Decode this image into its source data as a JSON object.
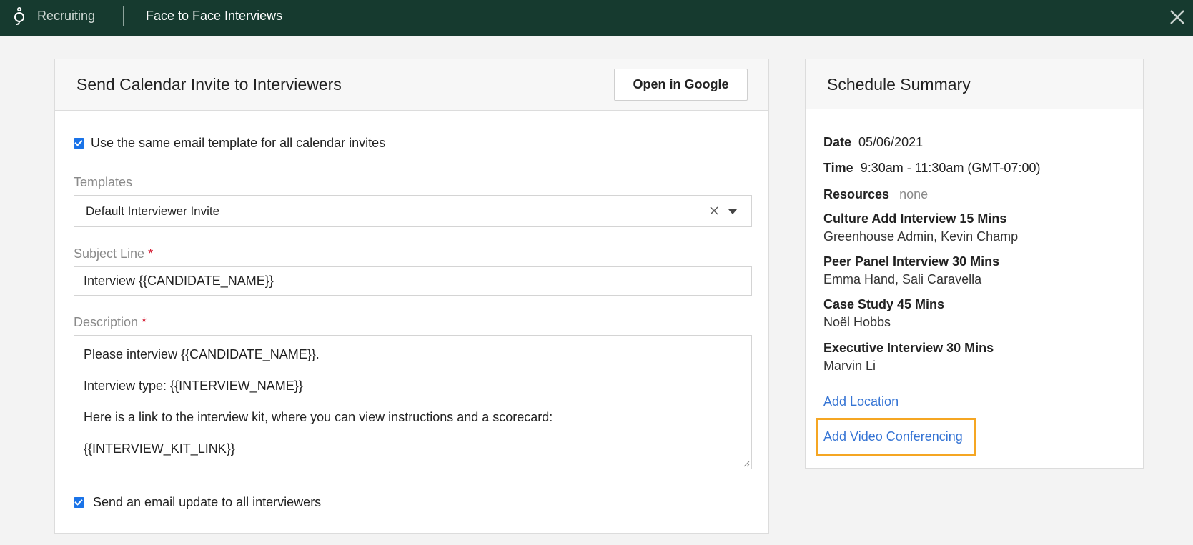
{
  "header": {
    "app_name": "Recruiting",
    "page_title": "Face to Face Interviews"
  },
  "invite_card": {
    "title": "Send Calendar Invite to Interviewers",
    "open_google_label": "Open in Google",
    "same_template_label": "Use the same email template for all calendar invites",
    "same_template_checked": true,
    "templates_label": "Templates",
    "template_value": "Default Interviewer Invite",
    "subject_label": "Subject Line",
    "subject_value": "Interview {{CANDIDATE_NAME}}",
    "required_mark": "*",
    "description_label": "Description",
    "description_lines": [
      "Please interview {{CANDIDATE_NAME}}.",
      "Interview type: {{INTERVIEW_NAME}}",
      "Here is a link to the interview kit, where you can view instructions and a scorecard:",
      "{{INTERVIEW_KIT_LINK}}"
    ],
    "send_update_label": "Send an email update to all interviewers",
    "send_update_checked": true
  },
  "summary_card": {
    "title": "Schedule Summary",
    "date_label": "Date",
    "date_value": "05/06/2021",
    "time_label": "Time",
    "time_value": "9:30am - 11:30am (GMT-07:00)",
    "resources_label": "Resources",
    "resources_value": "none",
    "interviews": [
      {
        "name": "Culture Add Interview 15 Mins",
        "people": "Greenhouse Admin, Kevin Champ"
      },
      {
        "name": "Peer Panel Interview 30 Mins",
        "people": "Emma Hand, Sali Caravella"
      },
      {
        "name": "Case Study 45 Mins",
        "people": "Noël Hobbs"
      },
      {
        "name": "Executive Interview 30 Mins",
        "people": "Marvin Li"
      }
    ],
    "add_location_label": "Add Location",
    "add_video_label": "Add Video Conferencing"
  },
  "colors": {
    "header_bg": "#163a2f",
    "link": "#3574d4",
    "checkbox": "#1a73e8",
    "highlight": "#f5a623",
    "required": "#d0021b"
  }
}
